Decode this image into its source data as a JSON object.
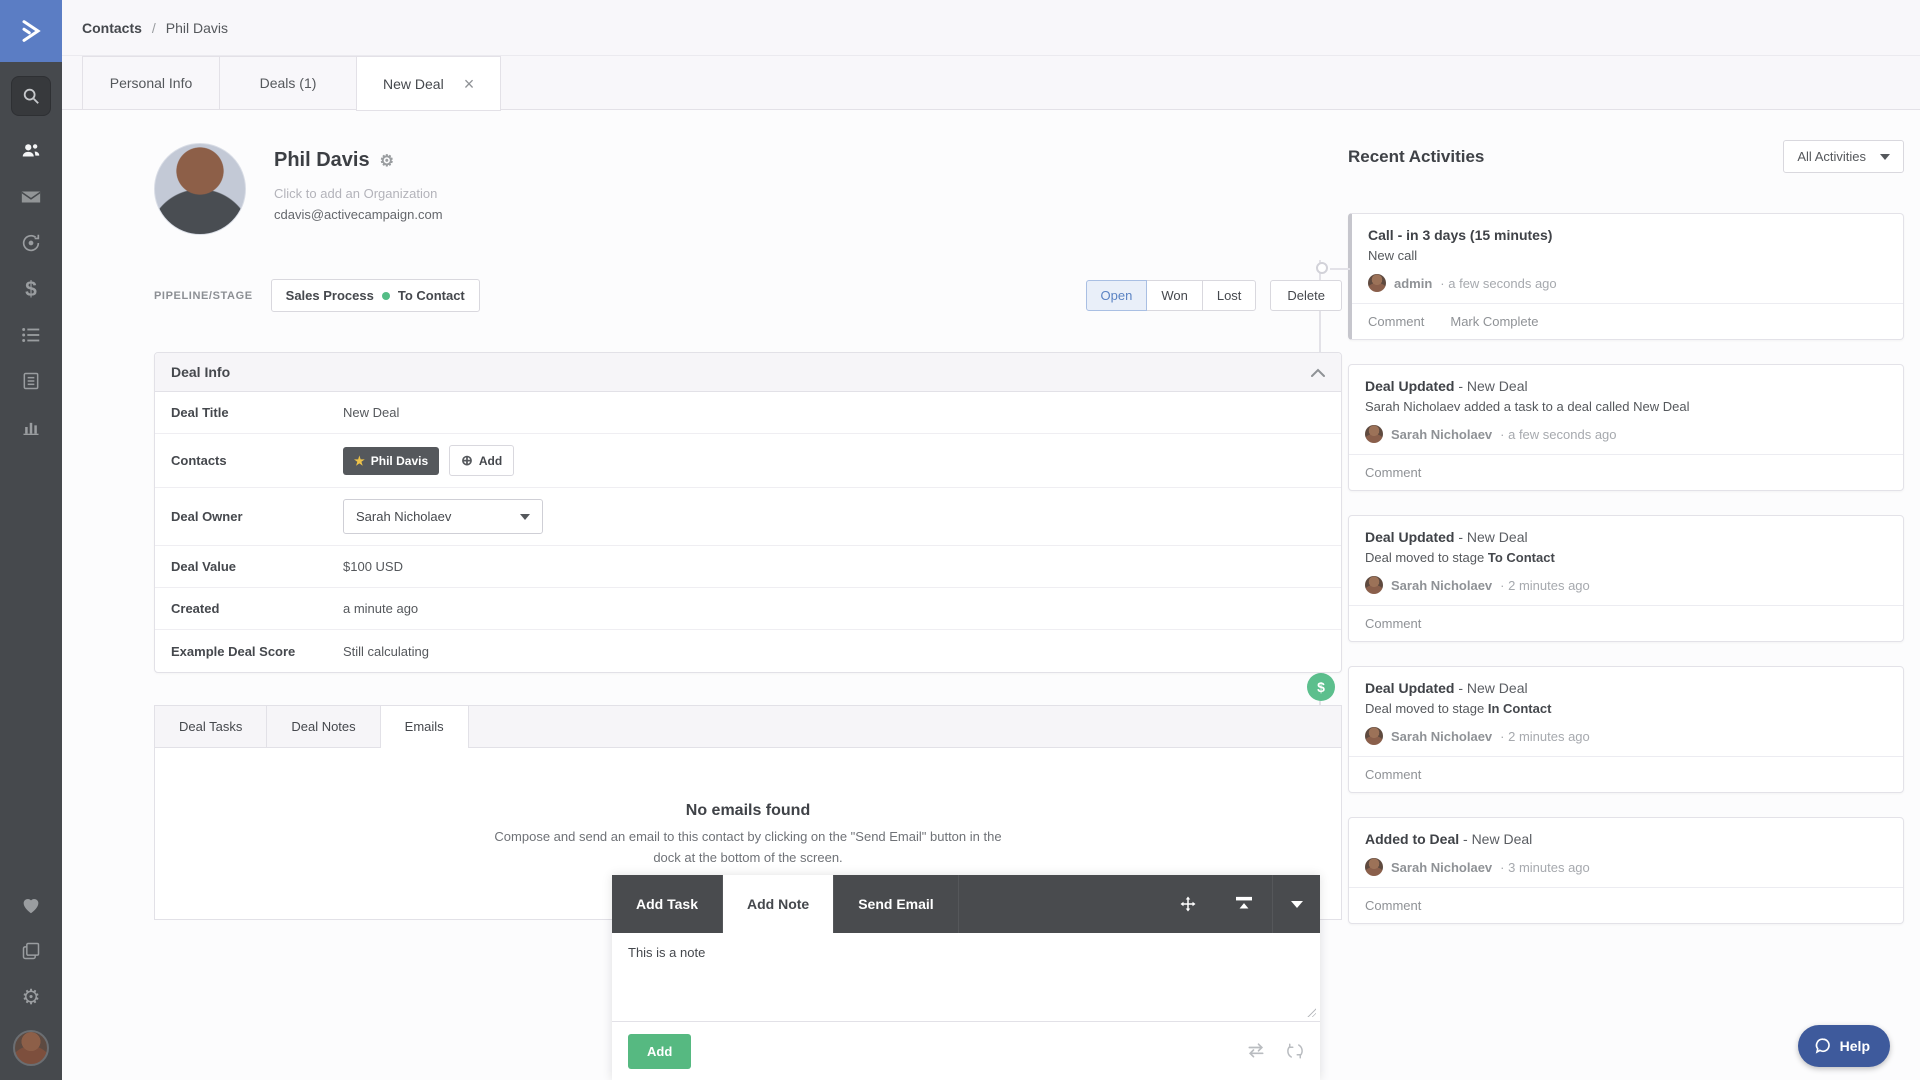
{
  "brand": {
    "accent_blue": "#5b7dc4",
    "green": "#54bd86",
    "open_blue": "#5b83c3",
    "help_navy": "#3e5a9c"
  },
  "breadcrumb": {
    "section": "Contacts",
    "separator": "/",
    "current": "Phil Davis"
  },
  "page_tabs": {
    "personal_info": "Personal Info",
    "deals": "Deals (1)",
    "new_deal": "New Deal",
    "close_glyph": "×"
  },
  "sidebar": {
    "icons": [
      "activecampaign-logo-icon",
      "search-icon",
      "contacts-icon",
      "campaigns-icon",
      "automations-icon",
      "deals-icon",
      "lists-icon",
      "forms-icon",
      "reports-icon",
      "heart-icon",
      "apps-icon",
      "settings-icon",
      "user-avatar"
    ]
  },
  "contact": {
    "name": "Phil Davis",
    "organization_placeholder": "Click to add an Organization",
    "email": "cdavis@activecampaign.com"
  },
  "pipeline": {
    "label": "PIPELINE/STAGE",
    "pipeline_name": "Sales Process",
    "stage_name": "To Contact",
    "status_open": "Open",
    "status_won": "Won",
    "status_lost": "Lost",
    "delete_label": "Delete",
    "active_status": "Open"
  },
  "deal_info": {
    "header": "Deal Info",
    "rows": {
      "title": {
        "label": "Deal Title",
        "value": "New Deal"
      },
      "contacts": {
        "label": "Contacts",
        "chip_star": "★",
        "chip": "Phil Davis",
        "add_plus": "⊕",
        "add": "Add"
      },
      "owner": {
        "label": "Deal Owner",
        "value": "Sarah Nicholaev"
      },
      "value": {
        "label": "Deal Value",
        "value": "$100 USD"
      },
      "created": {
        "label": "Created",
        "value": "a minute ago"
      },
      "score": {
        "label": "Example Deal Score",
        "value": "Still calculating"
      }
    }
  },
  "deal_tabs": {
    "tasks": "Deal Tasks",
    "notes": "Deal Notes",
    "emails": "Emails",
    "active": "Emails",
    "empty_title": "No emails found",
    "empty_line1": "Compose and send an email to this contact by clicking on the \"Send Email\" button in the",
    "empty_line2": "dock at the bottom of the screen."
  },
  "dock": {
    "tab_add_task": "Add Task",
    "tab_add_note": "Add Note",
    "tab_send_email": "Send Email",
    "active_tab": "Add Note",
    "note_text": "This is a note",
    "add_label": "Add",
    "icons": [
      "move-icon",
      "expand-dock-icon",
      "caret-down-icon",
      "swap-icon",
      "sync-icon"
    ]
  },
  "activities": {
    "title": "Recent Activities",
    "filter_label": "All Activities",
    "dollar_glyph": "$",
    "items": [
      {
        "title_bold": "Call - in 3 days (15 minutes)",
        "title_rest": "",
        "body": "New call",
        "body_bold": "",
        "author": "admin",
        "time": "· a few seconds ago",
        "link1": "Comment",
        "link2": "Mark Complete"
      },
      {
        "title_bold": "Deal Updated",
        "title_rest": " - New Deal",
        "body": "Sarah Nicholaev added a task to a deal called New Deal",
        "body_bold": "",
        "author": "Sarah Nicholaev",
        "time": "· a few seconds ago",
        "link1": "Comment"
      },
      {
        "title_bold": "Deal Updated",
        "title_rest": " - New Deal",
        "body": "Deal moved to stage ",
        "body_bold": "To Contact",
        "author": "Sarah Nicholaev",
        "time": "· 2 minutes ago",
        "link1": "Comment"
      },
      {
        "title_bold": "Deal Updated",
        "title_rest": " - New Deal",
        "body": "Deal moved to stage ",
        "body_bold": "In Contact",
        "author": "Sarah Nicholaev",
        "time": "· 2 minutes ago",
        "link1": "Comment"
      },
      {
        "title_bold": "Added to Deal",
        "title_rest": " - New Deal",
        "author": "Sarah Nicholaev",
        "time": "· 3 minutes ago",
        "link1": "Comment"
      }
    ]
  },
  "help": {
    "label": "Help"
  }
}
